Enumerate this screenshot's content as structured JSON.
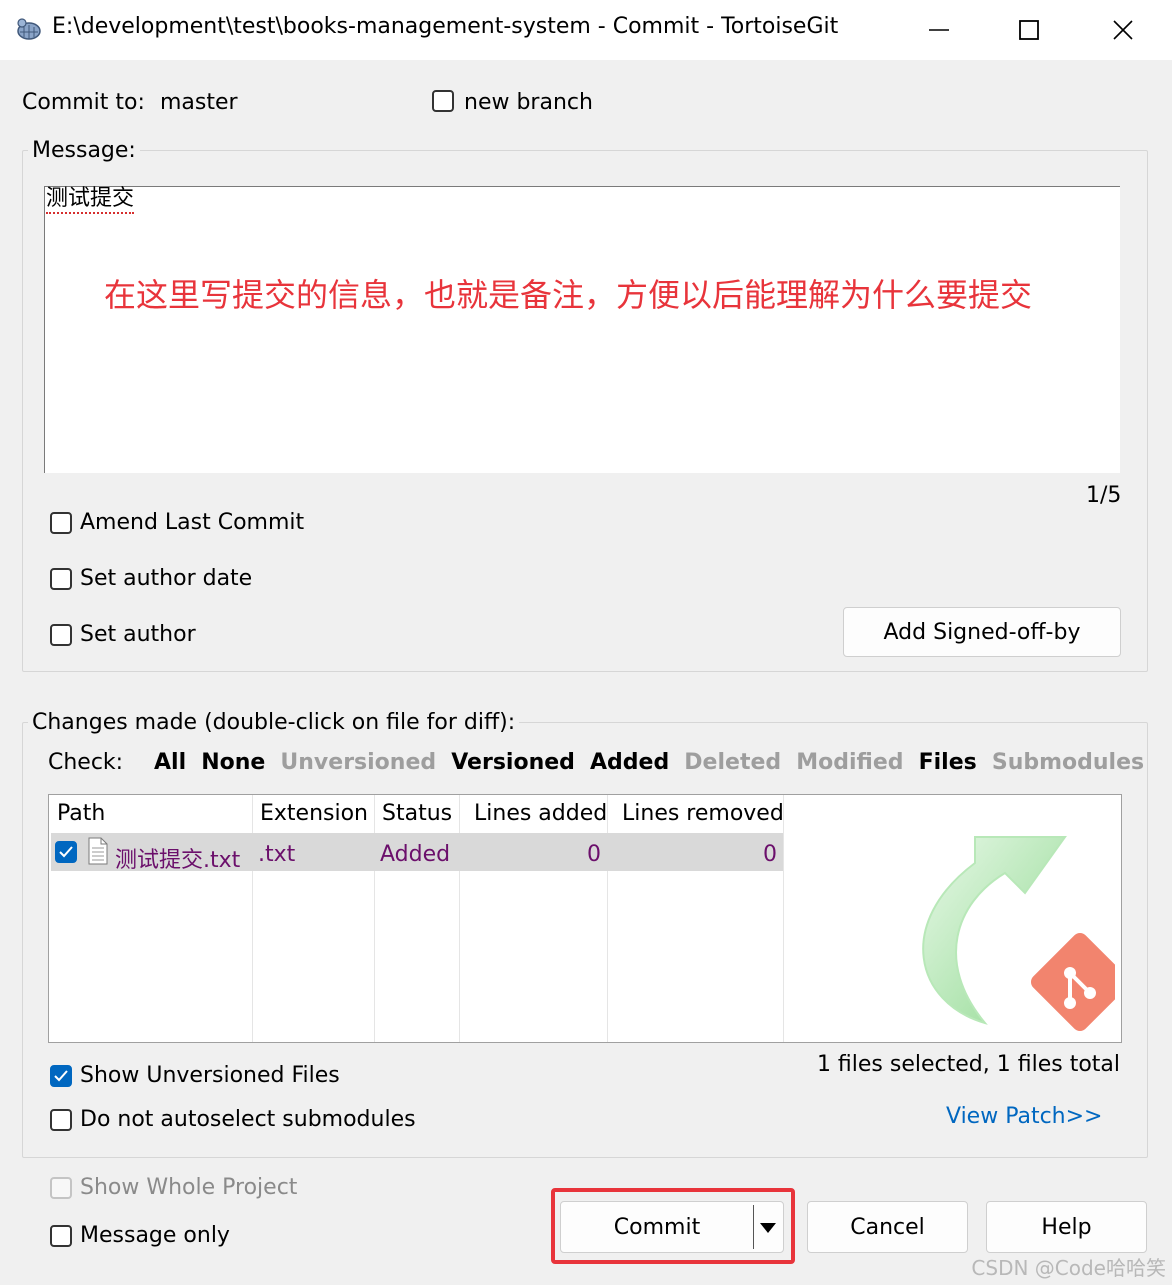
{
  "window": {
    "title": "E:\\development\\test\\books-management-system - Commit - TortoiseGit"
  },
  "commit_to": {
    "label": "Commit to:",
    "branch": "master",
    "new_branch_label": "new branch"
  },
  "message": {
    "group_label": "Message:",
    "text": "测试提交",
    "counter": "1/5",
    "annotation": "在这里写提交的信息，也就是备注，方便以后能理解为什么要提交"
  },
  "options": {
    "amend_label": "Amend Last Commit",
    "set_author_date_label": "Set author date",
    "set_author_label": "Set author",
    "signed_off_button": "Add Signed-off-by"
  },
  "changes": {
    "group_label": "Changes made (double-click on file for diff):",
    "check_label": "Check:",
    "filters": [
      {
        "label": "All",
        "enabled": true
      },
      {
        "label": "None",
        "enabled": true
      },
      {
        "label": "Unversioned",
        "enabled": false
      },
      {
        "label": "Versioned",
        "enabled": true
      },
      {
        "label": "Added",
        "enabled": true
      },
      {
        "label": "Deleted",
        "enabled": false
      },
      {
        "label": "Modified",
        "enabled": false
      },
      {
        "label": "Files",
        "enabled": true
      },
      {
        "label": "Submodules",
        "enabled": false
      }
    ],
    "columns": [
      "Path",
      "Extension",
      "Status",
      "Lines added",
      "Lines removed"
    ],
    "rows": [
      {
        "checked": true,
        "path": "测试提交.txt",
        "extension": ".txt",
        "status": "Added",
        "lines_added": "0",
        "lines_removed": "0"
      }
    ],
    "selection_summary": "1 files selected, 1 files total",
    "show_unversioned_label": "Show Unversioned Files",
    "no_autoselect_label": "Do not autoselect submodules",
    "view_patch_label": "View Patch>>"
  },
  "footer": {
    "show_whole_project_label": "Show Whole Project",
    "message_only_label": "Message only",
    "commit_button": "Commit",
    "cancel_button": "Cancel",
    "help_button": "Help"
  },
  "watermark": "CSDN @Code哈哈笑",
  "colors": {
    "accent": "#0067c0",
    "annotation_red": "#e8343b",
    "added_file_purple": "#6b0f6b",
    "disabled_gray": "#9e9e9e"
  },
  "icons": {
    "app": "tortoisegit-icon",
    "file": "text-file-icon",
    "watermark_logo": "git-commit-arrow-logo"
  }
}
